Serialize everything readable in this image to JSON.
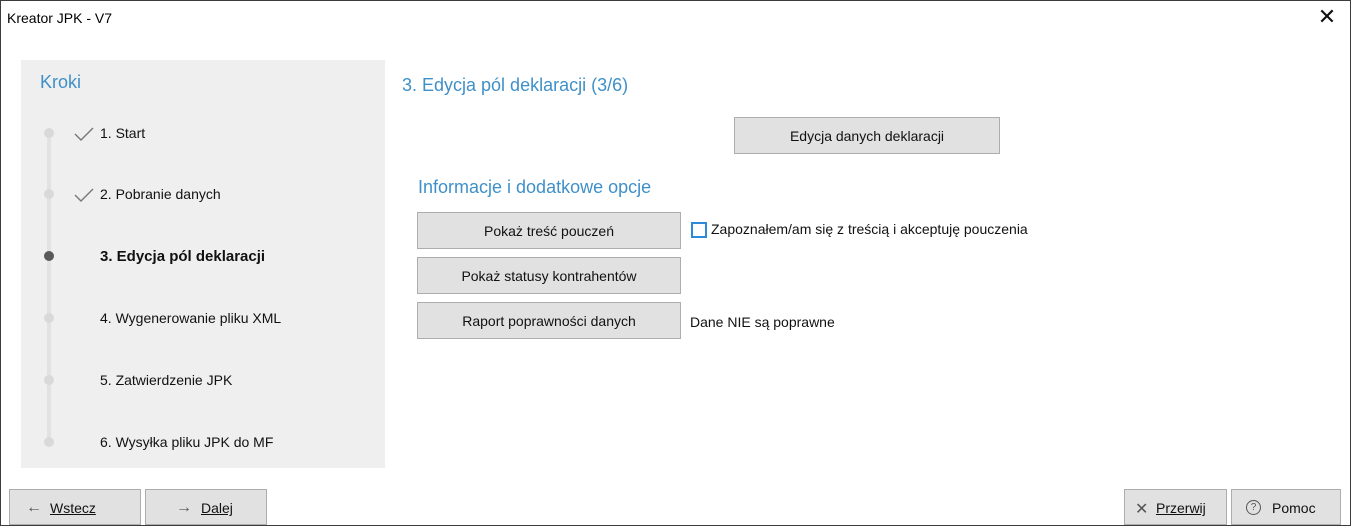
{
  "window": {
    "title": "Kreator JPK - V7",
    "close_glyph": "✕"
  },
  "sidebar": {
    "title": "Kroki",
    "steps": [
      {
        "label": "1. Start",
        "state": "done"
      },
      {
        "label": "2. Pobranie danych",
        "state": "done"
      },
      {
        "label": "3. Edycja pól deklaracji",
        "state": "active"
      },
      {
        "label": "4. Wygenerowanie pliku XML",
        "state": "pending"
      },
      {
        "label": "5. Zatwierdzenie JPK",
        "state": "pending"
      },
      {
        "label": "6. Wysyłka pliku JPK do MF",
        "state": "pending"
      }
    ]
  },
  "main": {
    "title": "3. Edycja pól deklaracji (3/6)",
    "edit_button": "Edycja danych deklaracji",
    "section_title": "Informacje i dodatkowe opcje",
    "show_instructions_button": "Pokaż treść pouczeń",
    "accept_checkbox": {
      "label": "Zapoznałem/am się z treścią i akceptuję pouczenia",
      "checked": false
    },
    "contractor_status_button": "Pokaż statusy kontrahentów",
    "report_button": "Raport poprawności danych",
    "data_status": "Dane NIE są poprawne"
  },
  "footer": {
    "back": {
      "icon": "←",
      "label": "Wstecz"
    },
    "next": {
      "icon": "→",
      "label": "Dalej"
    },
    "cancel": {
      "icon": "✕",
      "label": "Przerwij"
    },
    "help": {
      "icon": "?",
      "label": "Pomoc"
    }
  },
  "colors": {
    "accent": "#3f90c9",
    "sidebar_bg": "#efefef",
    "button_bg": "#e1e1e1",
    "checkbox_border": "#2e8ad8"
  }
}
